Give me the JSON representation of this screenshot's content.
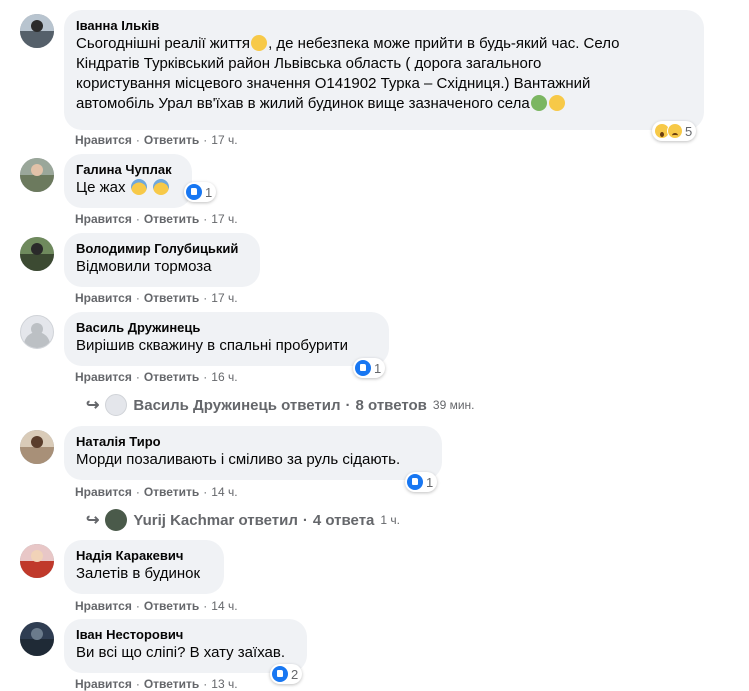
{
  "labels": {
    "like": "Нравится",
    "reply": "Ответить"
  },
  "comments": [
    {
      "author": "Іванна Ільків",
      "lines": [
        "Сьогоднішні реалії життя",
        ", де небезпека може прийти в будь-який час. Село",
        "Кіндратів Турківський район Львівська область ( дорога загального",
        "користування місцевого значення О141902 Турка – Східниця.) Вантажний",
        "автомобіль Урал вв'їхав в жилий будинок вище зазначеного села"
      ],
      "time": "17 ч.",
      "reaction_count": "5"
    },
    {
      "author": "Галина Чуплак",
      "text": "Це жах",
      "time": "17 ч.",
      "reaction_count": "1"
    },
    {
      "author": "Володимир Голубицький",
      "text": "Відмовили тормоза",
      "time": "17 ч."
    },
    {
      "author": "Василь Дружинець",
      "text": "Вирішив скважину в спальні пробурити",
      "time": "16 ч.",
      "reaction_count": "1",
      "replies": {
        "name": "Василь Дружинець",
        "verb": "ответил",
        "count": "8 ответов",
        "time": "39 мин."
      }
    },
    {
      "author": "Наталія Тиро",
      "text": "Морди позаливають і сміливо за руль сідають.",
      "time": "14 ч.",
      "reaction_count": "1",
      "replies": {
        "name": "Yurij Kachmar",
        "verb": "ответил",
        "count": "4 ответа",
        "time": "1 ч."
      }
    },
    {
      "author": "Надія Каракевич",
      "text": "Залетів в будинок",
      "time": "14 ч."
    },
    {
      "author": "Іван Несторович",
      "text": "Ви всі що сліпі? В хату заїхав.",
      "time": "13 ч.",
      "reaction_count": "2"
    }
  ],
  "icons": {
    "like": "like-reaction-icon",
    "wow": "wow-reaction-icon",
    "sad": "sad-reaction-icon",
    "reply_arrow": "reply-arrow-icon"
  },
  "colors": {
    "bubble": "#f0f2f5",
    "meta": "#65676b",
    "like_blue": "#1877f2"
  }
}
